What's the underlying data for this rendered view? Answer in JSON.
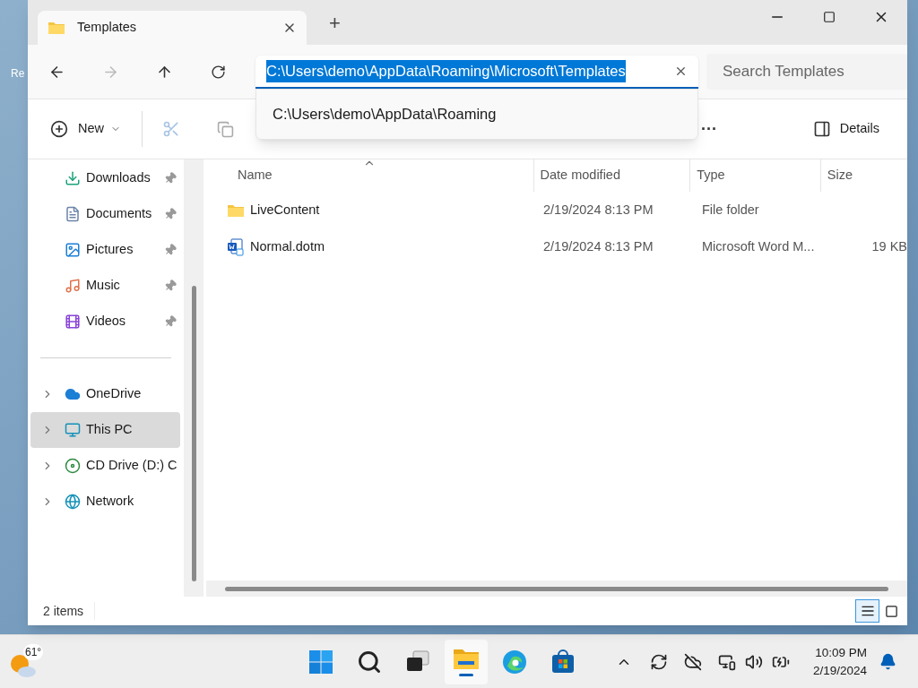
{
  "desktop": {
    "icon_label": "Re"
  },
  "tab": {
    "title": "Templates",
    "new_tab": "+"
  },
  "address": {
    "value": "C:\\Users\\demo\\AppData\\Roaming\\Microsoft\\Templates",
    "highlighted": true,
    "suggestions": [
      "C:\\Users\\demo\\AppData\\Roaming"
    ]
  },
  "search": {
    "placeholder": "Search Templates"
  },
  "toolbar": {
    "new_label": "New",
    "more": "···",
    "details_label": "Details"
  },
  "sidebar": {
    "items": [
      {
        "kind": "quick",
        "label": "Downloads",
        "pinned": true,
        "selected": false
      },
      {
        "kind": "quick",
        "label": "Documents",
        "pinned": true,
        "selected": false
      },
      {
        "kind": "quick",
        "label": "Pictures",
        "pinned": true,
        "selected": false
      },
      {
        "kind": "quick",
        "label": "Music",
        "pinned": true,
        "selected": false
      },
      {
        "kind": "quick",
        "label": "Videos",
        "pinned": true,
        "selected": false
      },
      {
        "kind": "divider"
      },
      {
        "kind": "tree",
        "label": "OneDrive",
        "expanded": false,
        "selected": false
      },
      {
        "kind": "tree",
        "label": "This PC",
        "expanded": false,
        "selected": true
      },
      {
        "kind": "tree",
        "label": "CD Drive (D:) C",
        "expanded": false,
        "selected": false
      },
      {
        "kind": "tree",
        "label": "Network",
        "expanded": false,
        "selected": false
      }
    ]
  },
  "table": {
    "columns": [
      {
        "label": "Name",
        "sorted": true
      },
      {
        "label": "Date modified",
        "sorted": false
      },
      {
        "label": "Type",
        "sorted": false
      },
      {
        "label": "Size",
        "sorted": false
      }
    ],
    "rows": [
      {
        "kind": "folder",
        "name": "LiveContent",
        "date": "2/19/2024 8:13 PM",
        "type": "File folder",
        "size": null
      },
      {
        "kind": "word",
        "name": "Normal.dotm",
        "date": "2/19/2024 8:13 PM",
        "type": "Microsoft Word M...",
        "size": "19 KB"
      }
    ]
  },
  "status_bar": {
    "count": "2 items",
    "views": [
      {
        "kind": "details",
        "selected": true
      },
      {
        "kind": "tiles",
        "selected": false
      }
    ]
  },
  "taskbar": {
    "weather": "61°",
    "apps": [
      {
        "kind": "start",
        "selected": false
      },
      {
        "kind": "search",
        "selected": false
      },
      {
        "kind": "taskview",
        "selected": false
      },
      {
        "kind": "explorer",
        "selected": true
      },
      {
        "kind": "edge",
        "selected": false
      },
      {
        "kind": "store",
        "selected": false
      }
    ],
    "time": "10:09 PM",
    "date": "2/19/2024"
  }
}
